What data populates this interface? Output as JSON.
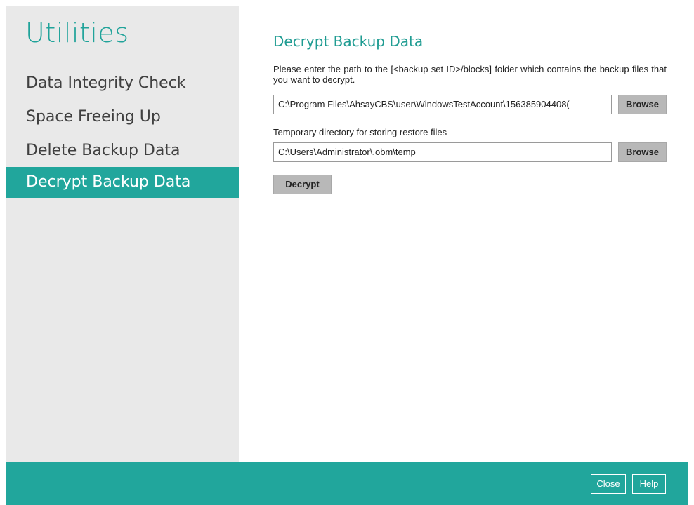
{
  "sidebar": {
    "title": "Utilities",
    "items": [
      {
        "label": "Data Integrity Check"
      },
      {
        "label": "Space Freeing Up"
      },
      {
        "label": "Delete Backup Data"
      },
      {
        "label": "Decrypt Backup Data",
        "active": true
      }
    ]
  },
  "main": {
    "title": "Decrypt Backup Data",
    "description": "Please enter the path to the [<backup set ID>/blocks] folder which contains the backup files that you want to decrypt.",
    "backup_path": {
      "value": "C:\\Program Files\\AhsayCBS\\user\\WindowsTestAccount\\156385904408("
    },
    "browse_label": "Browse",
    "temp_label": "Temporary directory for storing restore files",
    "temp_path": {
      "value": "C:\\Users\\Administrator\\.obm\\temp"
    },
    "decrypt_label": "Decrypt"
  },
  "footer": {
    "close_label": "Close",
    "help_label": "Help"
  },
  "colors": {
    "accent": "#21a69c",
    "sidebar_bg": "#e9e9e9",
    "button_bg": "#b8b8b8"
  }
}
